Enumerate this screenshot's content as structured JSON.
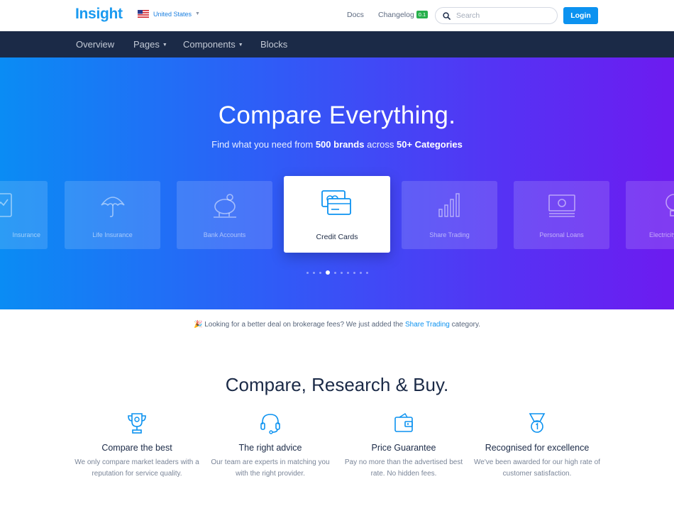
{
  "header": {
    "logo": "Insight",
    "country": "United States",
    "links": {
      "docs": "Docs",
      "changelog": "Changelog",
      "changelog_badge": "0.1"
    },
    "search": {
      "placeholder": "Search"
    },
    "login": "Login"
  },
  "nav": {
    "items": [
      {
        "label": "Overview"
      },
      {
        "label": "Pages"
      },
      {
        "label": "Components"
      },
      {
        "label": "Blocks"
      }
    ]
  },
  "hero": {
    "title": "Compare Everything.",
    "subtitle_prefix": "Find what you need from ",
    "subtitle_bold1": "500 brands",
    "subtitle_mid": " across ",
    "subtitle_bold2": "50+ Categories",
    "categories": [
      {
        "label": "Insurance",
        "icon": "document-icon"
      },
      {
        "label": "Life Insurance",
        "icon": "umbrella-icon"
      },
      {
        "label": "Bank Accounts",
        "icon": "piggy-bank-icon"
      },
      {
        "label": "Credit Cards",
        "icon": "credit-card-icon",
        "active": true
      },
      {
        "label": "Share Trading",
        "icon": "bar-chart-icon"
      },
      {
        "label": "Personal Loans",
        "icon": "banknote-icon"
      },
      {
        "label": "Electricity",
        "icon": "lightbulb-icon"
      }
    ],
    "carousel": {
      "total_dots": 10,
      "active_index": 3
    }
  },
  "notice": {
    "emoji": "🎉",
    "text_before": " Looking for a better deal on brokerage fees? We just added the ",
    "link": "Share Trading",
    "text_after": " category."
  },
  "features": {
    "title": "Compare, Research & Buy.",
    "items": [
      {
        "title": "Compare the best",
        "desc": "We only compare market leaders with a reputation for service quality.",
        "icon": "trophy-icon"
      },
      {
        "title": "The right advice",
        "desc": "Our team are experts in matching you with the right provider.",
        "icon": "headset-icon"
      },
      {
        "title": "Price Guarantee",
        "desc": "Pay no more than the advertised best rate. No hidden fees.",
        "icon": "wallet-icon"
      },
      {
        "title": "Recognised for excellence",
        "desc": "We've been awarded for our high rate of customer satisfaction.",
        "icon": "medal-icon"
      }
    ]
  },
  "colors": {
    "brand": "#1a9af0",
    "nav_bg": "#1b2a47",
    "button": "#0c92f0",
    "badge": "#27b04b"
  }
}
